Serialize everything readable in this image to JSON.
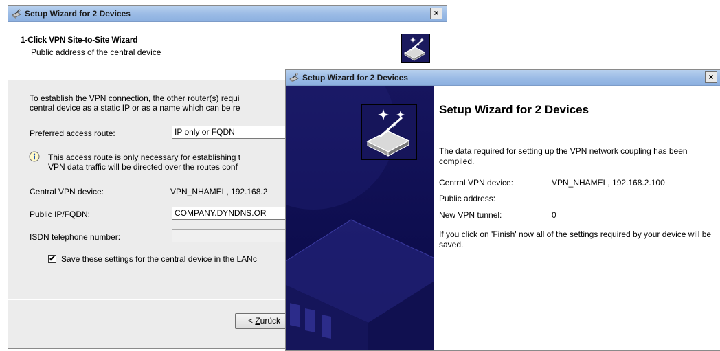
{
  "window1": {
    "title": "Setup Wizard for 2 Devices",
    "close_glyph": "×",
    "header": {
      "title": "1-Click VPN Site-to-Site Wizard",
      "subtitle": "Public address of the central device",
      "icon": "wizard-wand-icon"
    },
    "intro_line1": "To establish the VPN connection, the other router(s) requi",
    "intro_line2": "central device as a static IP or as a name which can be re",
    "access_route": {
      "label": "Preferred access route:",
      "value": "IP only or FQDN"
    },
    "info": {
      "icon": "info-icon",
      "line1": "This access route is only necessary for establishing t",
      "line2": "VPN data traffic will be directed over the routes conf"
    },
    "central_device": {
      "label": "Central VPN device:",
      "value": "VPN_NHAMEL, 192.168.2"
    },
    "public_ip": {
      "label": "Public IP/FQDN:",
      "value": "COMPANY.DYNDNS.OR"
    },
    "isdn": {
      "label": "ISDN telephone number:",
      "value": ""
    },
    "save_checkbox": {
      "checked": true,
      "check_glyph": "✔",
      "label": "Save these settings for the central device in the LANc"
    },
    "back_button": "< Zurück"
  },
  "window2": {
    "title": "Setup Wizard for 2 Devices",
    "close_glyph": "×",
    "heading": "Setup Wizard for 2 Devices",
    "para1": "The data required for setting up the VPN network coupling has been compiled.",
    "central_device": {
      "label": "Central VPN device:",
      "value": "VPN_NHAMEL, 192.168.2.100"
    },
    "public_address": {
      "label": "Public address:",
      "value": ""
    },
    "new_tunnel": {
      "label": "New VPN tunnel:",
      "value": "0"
    },
    "para2": "If you click on 'Finish' now all of the settings required by your device will be saved.",
    "side_icon": "wizard-wand-icon"
  },
  "colors": {
    "titlebar": "#9cbce6",
    "side_panel": "#0d0d4e",
    "window_bg": "#ececec"
  }
}
